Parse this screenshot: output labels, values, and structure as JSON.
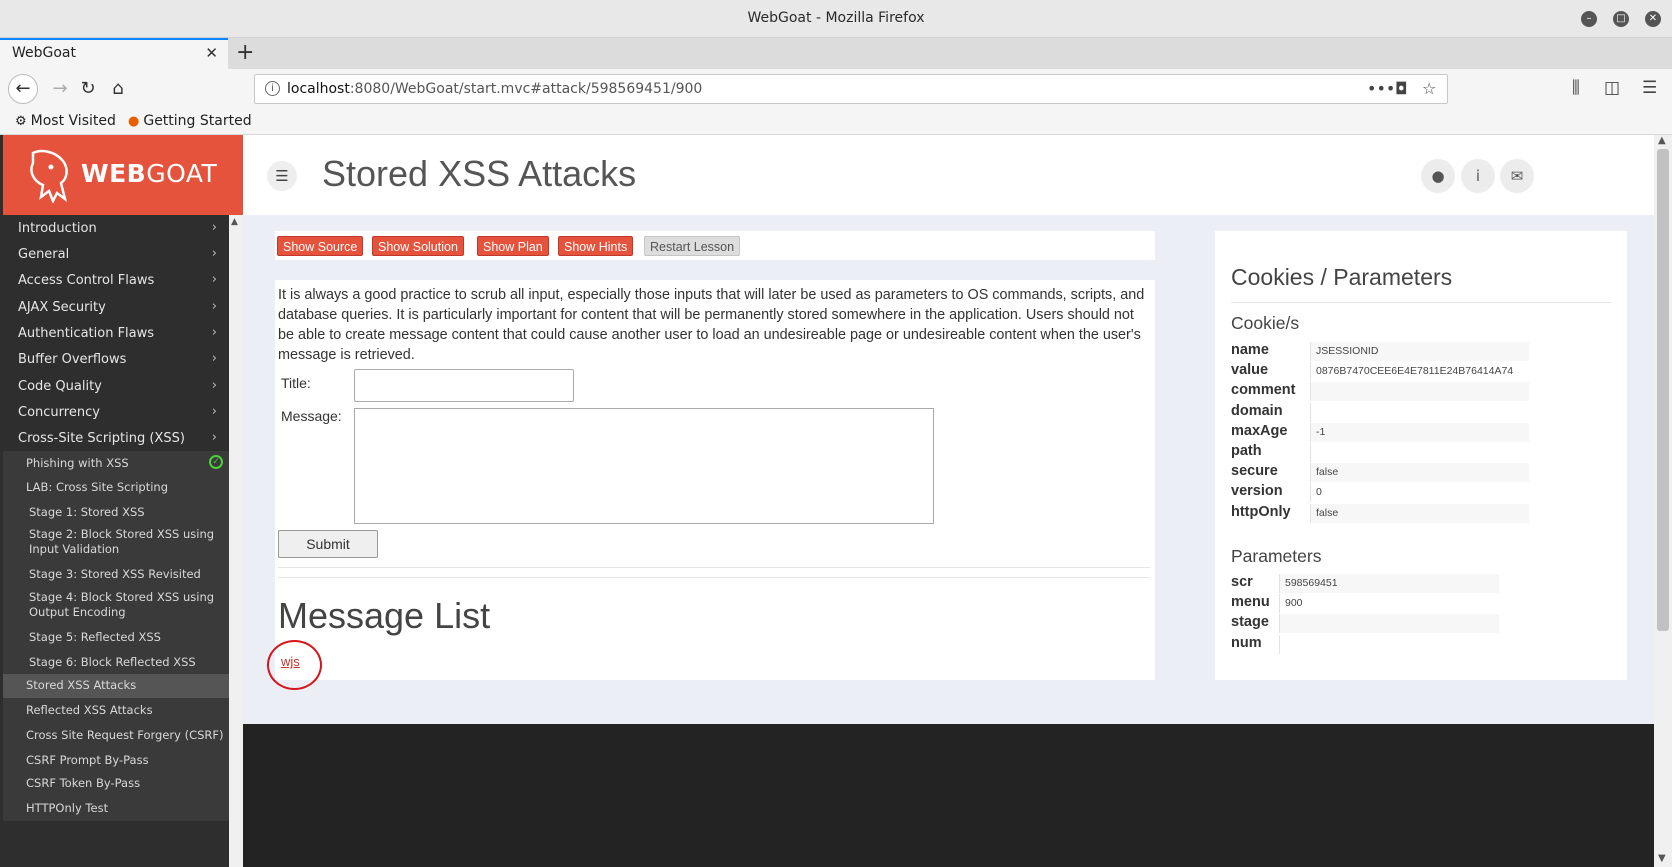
{
  "window": {
    "title": "WebGoat - Mozilla Firefox"
  },
  "tab": {
    "label": "WebGoat"
  },
  "urlbar": {
    "host": "localhost",
    "path": ":8080/WebGoat/start.mvc#attack/598569451/900"
  },
  "bookmarks": [
    {
      "label": "Most Visited",
      "icon": "gear-icon"
    },
    {
      "label": "Getting Started",
      "icon": "firefox-icon"
    }
  ],
  "brand": {
    "name_bold": "WEB",
    "name_light": "GOAT"
  },
  "menu": {
    "items": [
      "Introduction",
      "General",
      "Access Control Flaws",
      "AJAX Security",
      "Authentication Flaws",
      "Buffer Overflows",
      "Code Quality",
      "Concurrency",
      "Cross-Site Scripting (XSS)"
    ],
    "subitems": [
      {
        "label": "Phishing with XSS",
        "done": true
      },
      {
        "label": "LAB: Cross Site Scripting"
      },
      {
        "label": "Stage 1: Stored XSS"
      },
      {
        "label": "Stage 2: Block Stored XSS using Input Validation"
      },
      {
        "label": "Stage 3: Stored XSS Revisited"
      },
      {
        "label": "Stage 4: Block Stored XSS using Output Encoding"
      },
      {
        "label": "Stage 5: Reflected XSS"
      },
      {
        "label": "Stage 6: Block Reflected XSS"
      },
      {
        "label": "Stored XSS Attacks",
        "active": true
      },
      {
        "label": "Reflected XSS Attacks"
      },
      {
        "label": "Cross Site Request Forgery (CSRF)"
      },
      {
        "label": "CSRF Prompt By-Pass"
      },
      {
        "label": "CSRF Token By-Pass"
      },
      {
        "label": "HTTPOnly Test"
      }
    ]
  },
  "header": {
    "title": "Stored XSS Attacks"
  },
  "lesson_buttons": {
    "show_source": "Show Source",
    "show_solution": "Show Solution",
    "show_plan": "Show Plan",
    "show_hints": "Show Hints",
    "restart": "Restart Lesson"
  },
  "lesson": {
    "intro": "It is always a good practice to scrub all input, especially those inputs that will later be used as parameters to OS commands, scripts, and database queries. It is particularly important for content that will be permanently stored somewhere in the application. Users should not be able to create message content that could cause another user to load an undesireable page or undesireable content when the user's message is retrieved.",
    "title_label": "Title:",
    "title_value": "",
    "message_label": "Message:",
    "message_value": "",
    "submit_label": "Submit",
    "message_list_title": "Message List",
    "messages": [
      "wjs"
    ]
  },
  "cookies_panel": {
    "heading": "Cookies / Parameters",
    "cookies_heading": "Cookie/s",
    "cookies": [
      {
        "k": "name",
        "v": "JSESSIONID"
      },
      {
        "k": "value",
        "v": "0876B7470CEE6E4E7811E24B76414A74"
      },
      {
        "k": "comment",
        "v": ""
      },
      {
        "k": "domain",
        "v": ""
      },
      {
        "k": "maxAge",
        "v": "-1"
      },
      {
        "k": "path",
        "v": ""
      },
      {
        "k": "secure",
        "v": "false"
      },
      {
        "k": "version",
        "v": "0"
      },
      {
        "k": "httpOnly",
        "v": "false"
      }
    ],
    "params_heading": "Parameters",
    "params": [
      {
        "k": "scr",
        "v": "598569451"
      },
      {
        "k": "menu",
        "v": "900"
      },
      {
        "k": "stage",
        "v": ""
      },
      {
        "k": "num",
        "v": ""
      }
    ]
  },
  "colors": {
    "accent": "#e5533d",
    "sidebar": "#2e2e2e",
    "check": "#4cd137",
    "annotation": "#d6141c"
  }
}
